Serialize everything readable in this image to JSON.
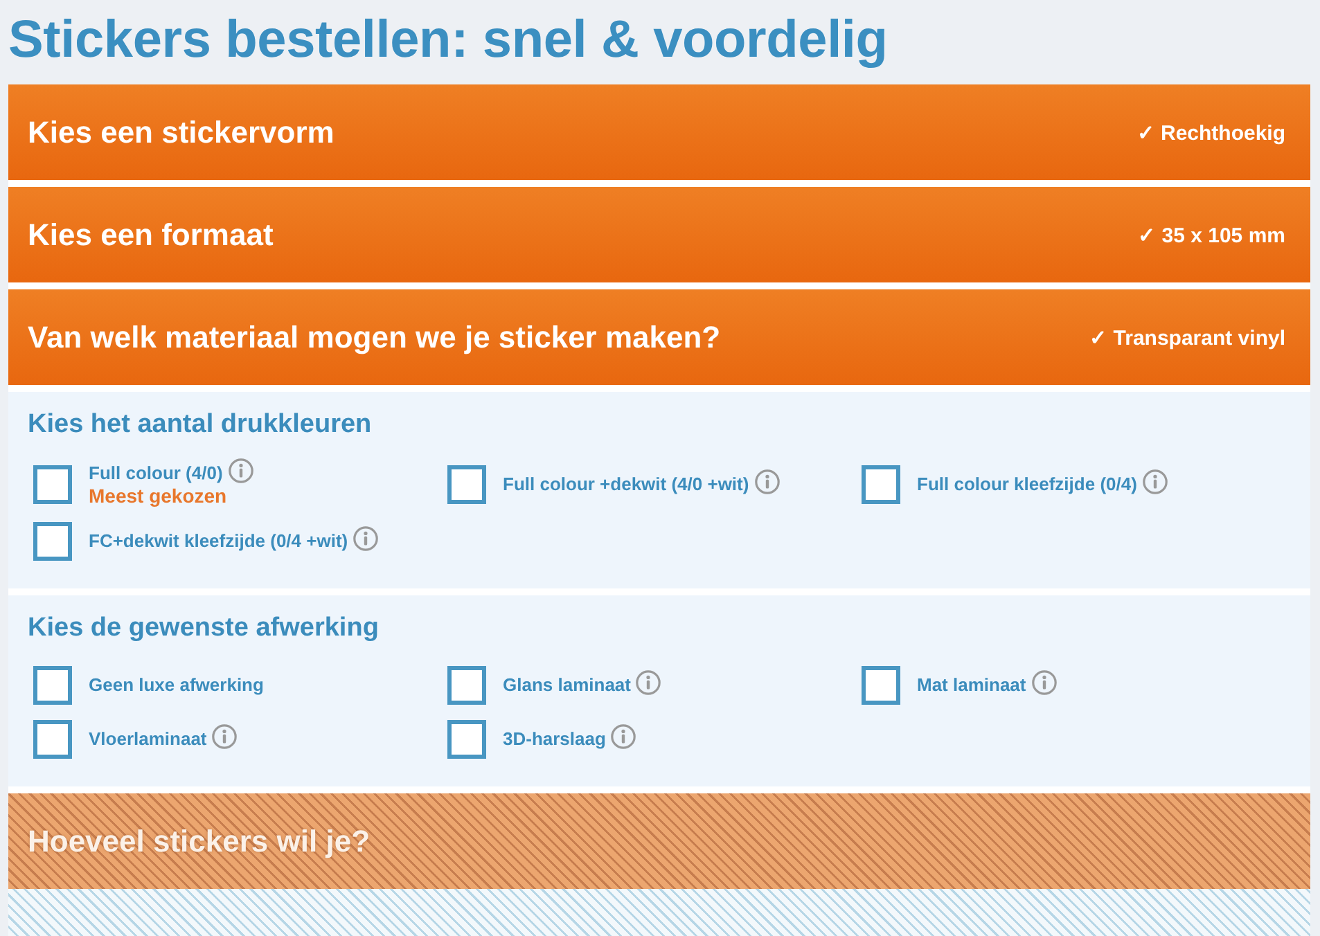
{
  "page_title": "Stickers bestellen: snel & voordelig",
  "steps": [
    {
      "kind": "done",
      "title": "Kies een stickervorm",
      "selection": "✓ Rechthoekig"
    },
    {
      "kind": "done",
      "title": "Kies een formaat",
      "selection": "✓ 35 x 105 mm"
    },
    {
      "kind": "done",
      "title": "Van welk materiaal mogen we je sticker maken?",
      "selection": "✓ Transparant vinyl"
    },
    {
      "kind": "open",
      "title": "Kies het aantal drukkleuren",
      "options": [
        {
          "label": "Full colour (4/0)",
          "note": "Meest gekozen",
          "info": true,
          "checked": false
        },
        {
          "label": "Full colour +dekwit (4/0 +wit)",
          "info": true,
          "checked": false
        },
        {
          "label": "Full colour kleefzijde (0/4)",
          "info": true,
          "checked": false
        },
        {
          "label": "FC+dekwit kleefzijde (0/4 +wit)",
          "info": true,
          "checked": false
        }
      ]
    },
    {
      "kind": "open",
      "title": "Kies de gewenste afwerking",
      "options": [
        {
          "label": "Geen luxe afwerking",
          "info": false,
          "checked": false
        },
        {
          "label": "Glans laminaat",
          "info": true,
          "checked": false
        },
        {
          "label": "Mat laminaat",
          "info": true,
          "checked": false
        },
        {
          "label": "Vloerlaminaat",
          "info": true,
          "checked": false
        },
        {
          "label": "3D-harslaag",
          "info": true,
          "checked": false
        }
      ]
    },
    {
      "kind": "locked",
      "title": "Hoeveel stickers wil je?"
    }
  ]
}
